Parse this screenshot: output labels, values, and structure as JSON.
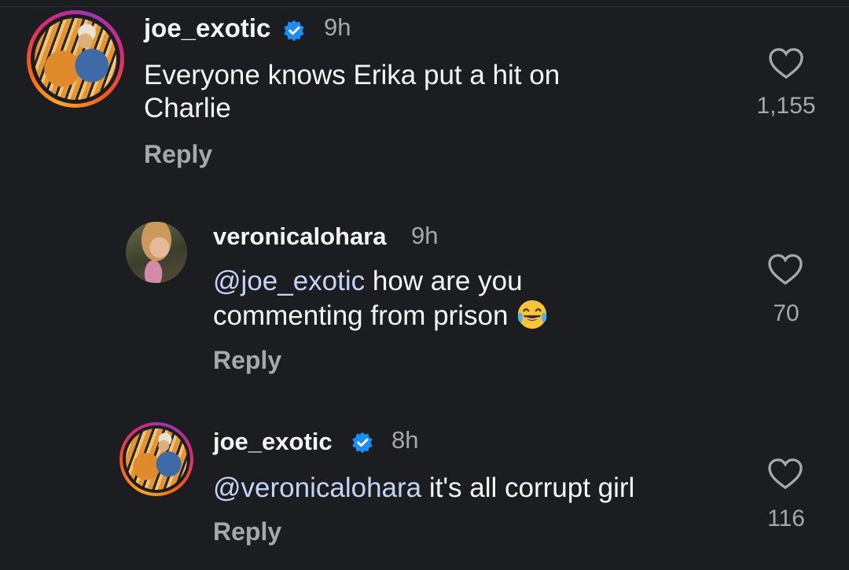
{
  "comments": [
    {
      "username": "joe_exotic",
      "verified": true,
      "time": "9h",
      "text_line1": "Everyone knows Erika put a hit on",
      "text_line2": "Charlie",
      "reply_label": "Reply",
      "likes": "1,155",
      "avatar_icon": "tiger-avatar"
    },
    {
      "username": "veronicalohara",
      "verified": false,
      "time": "9h",
      "mention": "@joe_exotic",
      "text_line1": " how are you",
      "text_line2": "commenting from prison",
      "emoji": "face-with-tears-of-joy-emoji",
      "reply_label": "Reply",
      "likes": "70",
      "avatar_icon": "woman-avatar"
    },
    {
      "username": "joe_exotic",
      "verified": true,
      "time": "8h",
      "mention": "@veronicalohara",
      "text_line1": " it's all corrupt girl",
      "reply_label": "Reply",
      "likes": "116",
      "avatar_icon": "tiger-avatar"
    }
  ],
  "colors": {
    "background": "#1b1d21",
    "verified_blue": "#1d8cf5",
    "mention": "#c5d4f5",
    "secondary_text": "#a8a8a8"
  }
}
